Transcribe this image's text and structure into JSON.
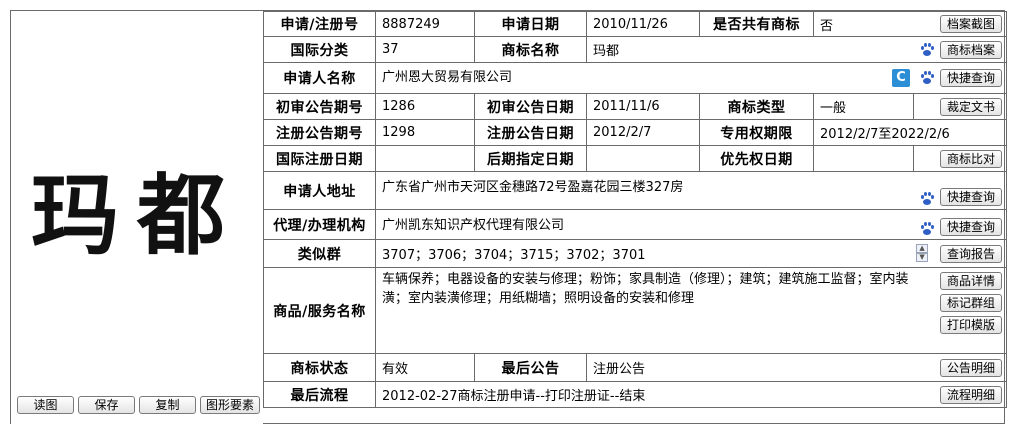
{
  "trademark_image_text": "玛都",
  "left_buttons": [
    {
      "label": "读图"
    },
    {
      "label": "保存"
    },
    {
      "label": "复制"
    },
    {
      "label": "图形要素"
    }
  ],
  "rows": {
    "app_no_label": "申请/注册号",
    "app_no": "8887249",
    "app_date_label": "申请日期",
    "app_date": "2010/11/26",
    "shared_label": "是否共有商标",
    "shared": "否",
    "archive_btn": "档案截图",
    "intl_class_label": "国际分类",
    "intl_class": "37",
    "tm_name_label": "商标名称",
    "tm_name": "玛都",
    "tm_archive_btn": "商标档案",
    "applicant_label": "申请人名称",
    "applicant": "广州恩大贸易有限公司",
    "quick_query_btn": "快捷查询",
    "prelim_no_label": "初审公告期号",
    "prelim_no": "1286",
    "prelim_date_label": "初审公告日期",
    "prelim_date": "2011/11/6",
    "tm_type_label": "商标类型",
    "tm_type": "一般",
    "ruling_btn": "裁定文书",
    "reg_no_label": "注册公告期号",
    "reg_no": "1298",
    "reg_date_label": "注册公告日期",
    "reg_date": "2012/2/7",
    "exclusive_label": "专用权期限",
    "exclusive": "2012/2/7至2022/2/6",
    "intl_reg_label": "国际注册日期",
    "intl_reg": "",
    "later_label": "后期指定日期",
    "later": "",
    "priority_label": "优先权日期",
    "priority": "",
    "compare_btn": "商标比对",
    "address_label": "申请人地址",
    "address": "广东省广州市天河区金穗路72号盈嘉花园三楼327房",
    "address_btn": "快捷查询",
    "agent_label": "代理/办理机构",
    "agent": "广州凯东知识产权代理有限公司",
    "agent_btn": "快捷查询",
    "similar_label": "类似群",
    "similar": "3707；3706；3704；3715；3702；3701",
    "report_btn": "查询报告",
    "goods_label": "商品/服务名称",
    "goods": "车辆保养；电器设备的安装与修理；粉饰；家具制造（修理）；建筑；建筑施工监督；室内装潢；室内装潢修理；用纸糊墙；照明设备的安装和修理",
    "goods_detail_btn": "商品详情",
    "mark_group_btn": "标记群组",
    "print_btn": "打印模版",
    "status_label": "商标状态",
    "status": "有效",
    "last_notice_label": "最后公告",
    "last_notice": "注册公告",
    "notice_btn": "公告明细",
    "last_flow_label": "最后流程",
    "last_flow": "2012-02-27商标注册申请--打印注册证--结束",
    "flow_btn": "流程明细"
  },
  "icons": {
    "paw": "baidu-paw-icon",
    "c_logo": "c-logo-icon",
    "spinner": "spinner-icon"
  },
  "colors": {
    "border": "#6a6a6a",
    "paw_blue": "#2f5fc4",
    "c_blue": "#2c8fd6"
  }
}
